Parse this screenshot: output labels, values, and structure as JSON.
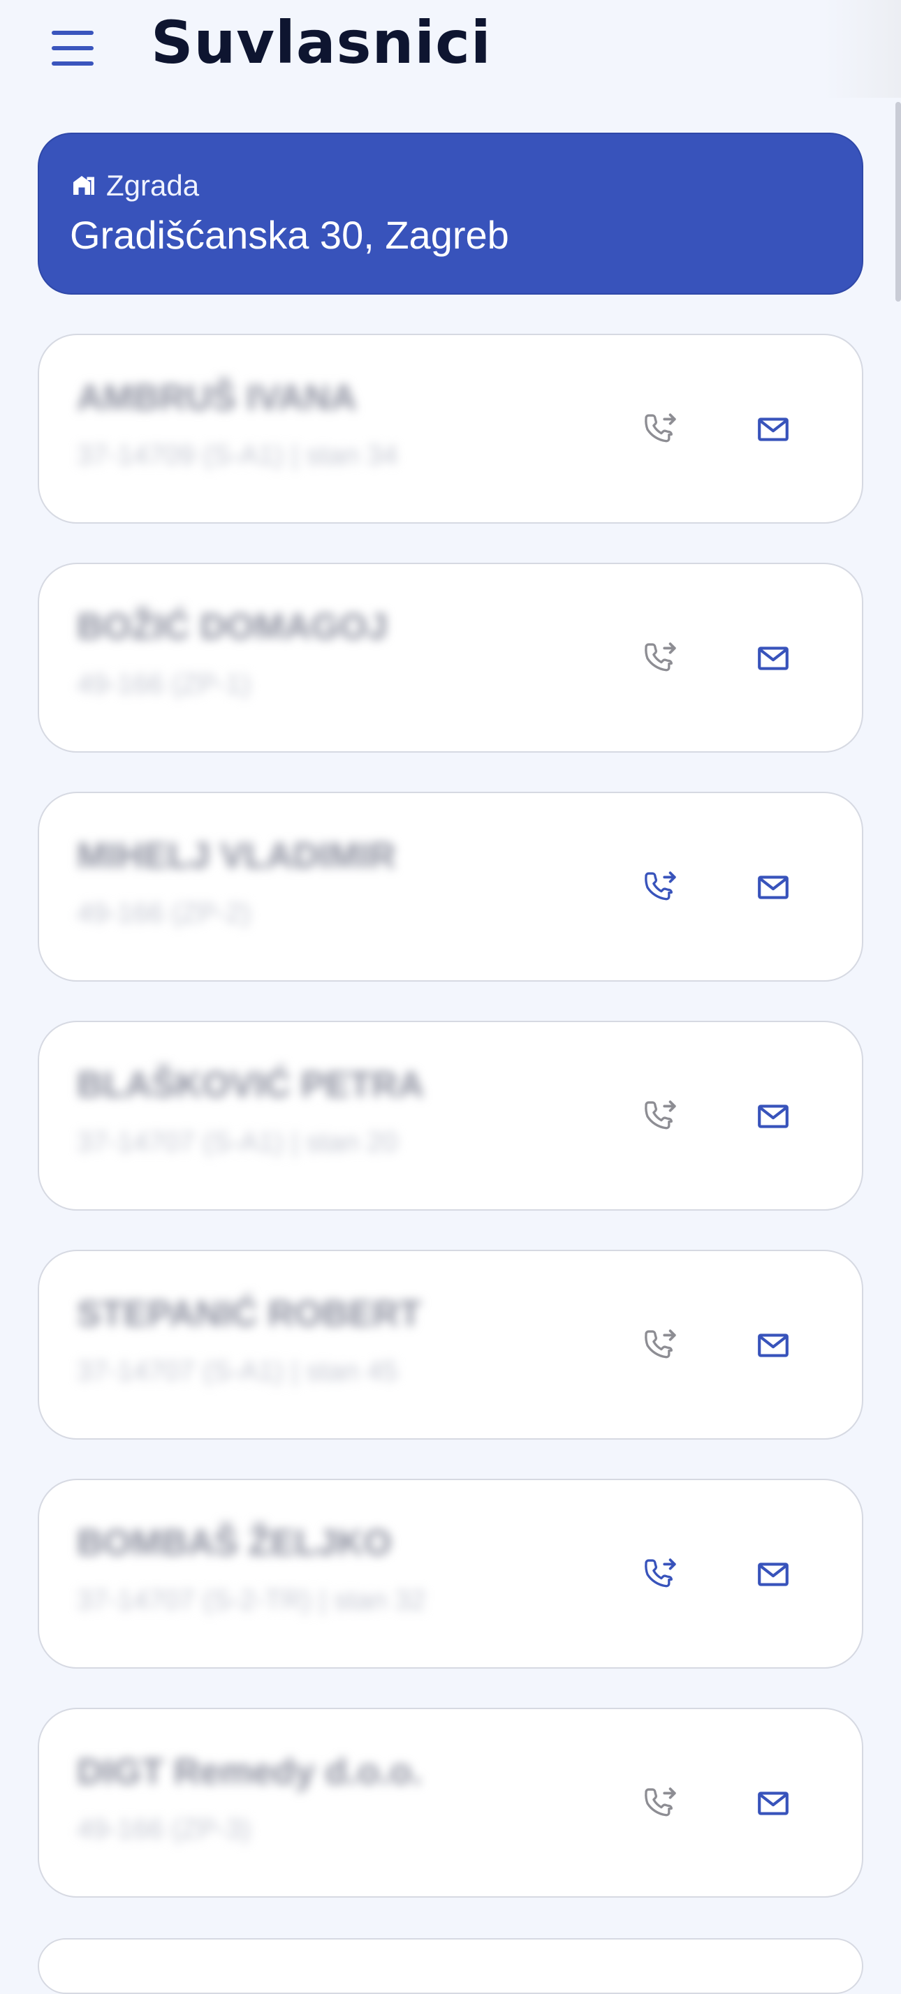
{
  "header": {
    "title": "Suvlasnici",
    "menu_icon": "menu-icon"
  },
  "building": {
    "label": "Zgrada",
    "icon": "building-icon",
    "address": "Gradišćanska 30, Zagreb"
  },
  "owners": [
    {
      "name": "AMBRUŠ IVANA",
      "detail": "37-14709 (S-A1) | stan 34",
      "phone_enabled": false
    },
    {
      "name": "BOŽIĆ DOMAGOJ",
      "detail": "49-166 (ZP-1)",
      "phone_enabled": false
    },
    {
      "name": "MIHELJ VLADIMIR",
      "detail": "49-166 (ZP-2)",
      "phone_enabled": true
    },
    {
      "name": "BLAŠKOVIĆ PETRA",
      "detail": "37-14707 (S-A1) | stan 20",
      "phone_enabled": false
    },
    {
      "name": "STEPANIĆ ROBERT",
      "detail": "37-14707 (S-A1) | stan 45",
      "phone_enabled": false
    },
    {
      "name": "BOMBAŠ ŽELJKO",
      "detail": "37-14707 (S-2-TR) | stan 32",
      "phone_enabled": true
    },
    {
      "name": "DIGT Remedy d.o.o.",
      "detail": "49-166 (ZP-3)",
      "phone_enabled": false
    }
  ],
  "icons": {
    "call": "phone-forward-icon",
    "mail": "mail-icon"
  },
  "colors": {
    "accent": "#3853bb",
    "background": "#f3f6fd",
    "phone_disabled": "#8d8d93",
    "phone_enabled": "#3853bb"
  }
}
